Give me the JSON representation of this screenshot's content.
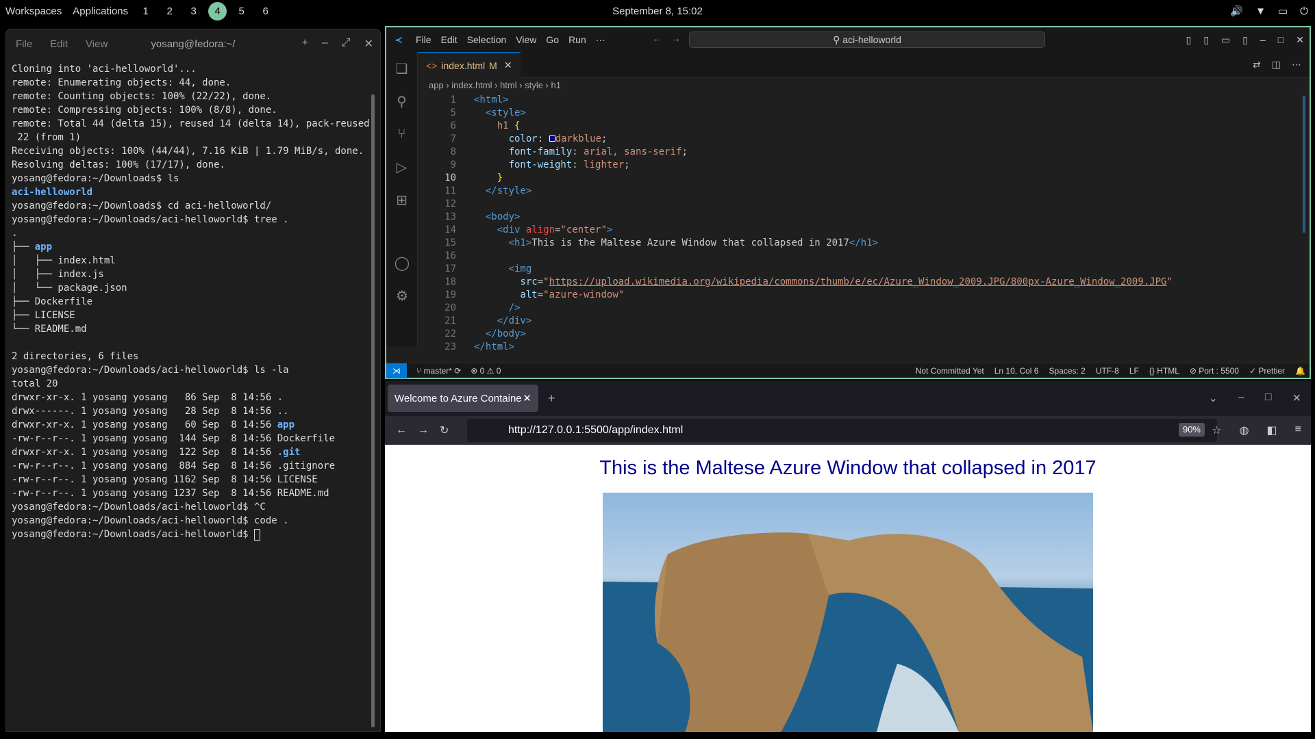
{
  "topbar": {
    "workspaces_label": "Workspaces",
    "applications_label": "Applications",
    "workspaces": [
      "1",
      "2",
      "3",
      "4",
      "5",
      "6"
    ],
    "active_workspace": "4",
    "clock": "September 8, 15:02"
  },
  "terminal": {
    "menu": [
      "File",
      "Edit",
      "View"
    ],
    "title": "yosang@fedora:~/",
    "lines": [
      "Cloning into 'aci-helloworld'...",
      "remote: Enumerating objects: 44, done.",
      "remote: Counting objects: 100% (22/22), done.",
      "remote: Compressing objects: 100% (8/8), done.",
      "remote: Total 44 (delta 15), reused 14 (delta 14), pack-reused",
      " 22 (from 1)",
      "Receiving objects: 100% (44/44), 7.16 KiB | 1.79 MiB/s, done.",
      "Resolving deltas: 100% (17/17), done.",
      "yosang@fedora:~/Downloads$ ls",
      "aci-helloworld",
      "yosang@fedora:~/Downloads$ cd aci-helloworld/",
      "yosang@fedora:~/Downloads/aci-helloworld$ tree .",
      ".",
      "├── app",
      "│   ├── index.html",
      "│   ├── index.js",
      "│   └── package.json",
      "├── Dockerfile",
      "├── LICENSE",
      "└── README.md",
      "",
      "2 directories, 6 files",
      "yosang@fedora:~/Downloads/aci-helloworld$ ls -la",
      "total 20",
      "drwxr-xr-x. 1 yosang yosang   86 Sep  8 14:56 .",
      "drwx------. 1 yosang yosang   28 Sep  8 14:56 ..",
      "drwxr-xr-x. 1 yosang yosang   60 Sep  8 14:56 app",
      "-rw-r--r--. 1 yosang yosang  144 Sep  8 14:56 Dockerfile",
      "drwxr-xr-x. 1 yosang yosang  122 Sep  8 14:56 .git",
      "-rw-r--r--. 1 yosang yosang  884 Sep  8 14:56 .gitignore",
      "-rw-r--r--. 1 yosang yosang 1162 Sep  8 14:56 LICENSE",
      "-rw-r--r--. 1 yosang yosang 1237 Sep  8 14:56 README.md",
      "yosang@fedora:~/Downloads/aci-helloworld$ ^C",
      "yosang@fedora:~/Downloads/aci-helloworld$ code .",
      "yosang@fedora:~/Downloads/aci-helloworld$ "
    ]
  },
  "vscode": {
    "menu": [
      "File",
      "Edit",
      "Selection",
      "View",
      "Go",
      "Run",
      "···"
    ],
    "search": "aci-helloworld",
    "tab_label": "index.html",
    "tab_badge": "M",
    "breadcrumb": [
      "app",
      "index.html",
      "html",
      "style",
      "h1"
    ],
    "code": [
      {
        "n": "1",
        "html": "<span class='tg'>&lt;html&gt;</span>"
      },
      {
        "n": "5",
        "html": "  <span class='tg'>&lt;style&gt;</span>"
      },
      {
        "n": "6",
        "html": "    <span class='st'>h1</span> <span class='br'>{</span>"
      },
      {
        "n": "7",
        "html": "      <span class='pr'>color</span>: <span style='display:inline-block;width:9px;height:9px;border:1px solid #fff;background:darkblue'></span><span class='st'>darkblue</span>;"
      },
      {
        "n": "8",
        "html": "      <span class='pr'>font-family</span>: <span class='st'>arial, sans-serif</span>;"
      },
      {
        "n": "9",
        "html": "      <span class='pr'>font-weight</span>: <span class='st'>lighter</span>;"
      },
      {
        "n": "10",
        "html": "    <span class='br'>}</span>"
      },
      {
        "n": "11",
        "html": "  <span class='tg'>&lt;/style&gt;</span>"
      },
      {
        "n": "12",
        "html": ""
      },
      {
        "n": "13",
        "html": "  <span class='tg'>&lt;body&gt;</span>"
      },
      {
        "n": "14",
        "html": "    <span class='tg'>&lt;div</span> <span class='ar'>align</span>=<span class='st'>\"center\"</span><span class='tg'>&gt;</span>"
      },
      {
        "n": "15",
        "html": "      <span class='tg'>&lt;h1&gt;</span>This is the Maltese Azure Window that collapsed in 2017<span class='tg'>&lt;/h1&gt;</span>"
      },
      {
        "n": "16",
        "html": ""
      },
      {
        "n": "17",
        "html": "      <span class='tg'>&lt;img</span>"
      },
      {
        "n": "18",
        "html": "        <span class='pr'>src</span>=<span class='st'>\"<span class='un'>https://upload.wikimedia.org/wikipedia/commons/thumb/e/ec/Azure_Window_2009.JPG/800px-Azure_Window_2009.JPG</span>\"</span>"
      },
      {
        "n": "19",
        "html": "        <span class='pr'>alt</span>=<span class='st'>\"azure-window\"</span>"
      },
      {
        "n": "20",
        "html": "      <span class='tg'>/&gt;</span>"
      },
      {
        "n": "21",
        "html": "    <span class='tg'>&lt;/div&gt;</span>"
      },
      {
        "n": "22",
        "html": "  <span class='tg'>&lt;/body&gt;</span>"
      },
      {
        "n": "23",
        "html": "<span class='tg'>&lt;/html&gt;</span>"
      }
    ],
    "status": {
      "branch": "master*",
      "problems": "⊗ 0 ⚠ 0",
      "right": [
        "Not Committed Yet",
        "Ln 10, Col 6",
        "Spaces: 2",
        "UTF-8",
        "LF",
        "{} HTML",
        "⊘ Port : 5500",
        "✓ Prettier"
      ]
    }
  },
  "browser": {
    "tab_title": "Welcome to Azure Containe",
    "url": "http://127.0.0.1:5500/app/index.html",
    "zoom": "90%",
    "heading": "This is the Maltese Azure Window that collapsed in 2017"
  }
}
